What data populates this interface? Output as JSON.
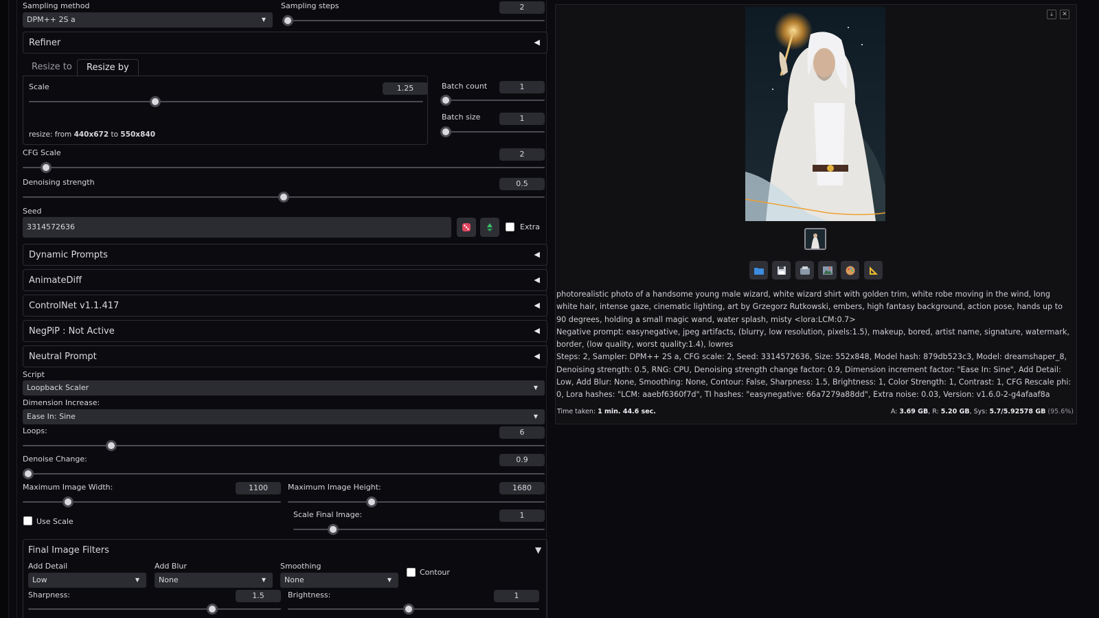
{
  "sampling": {
    "method_label": "Sampling method",
    "method_value": "DPM++ 2S a",
    "steps_label": "Sampling steps",
    "steps_value": "2"
  },
  "refiner": {
    "title": "Refiner"
  },
  "resize_tabs": {
    "tab1": "Resize to",
    "tab2": "Resize by"
  },
  "scale": {
    "label": "Scale",
    "value": "1.25",
    "fraction": 0.32
  },
  "resize_info": {
    "prefix": "resize: from ",
    "from": "440x672",
    "mid": " to ",
    "to": "550x840"
  },
  "batch": {
    "count_label": "Batch count",
    "count_value": "1",
    "size_label": "Batch size",
    "size_value": "1"
  },
  "cfg": {
    "label": "CFG Scale",
    "value": "2",
    "fraction": 0.045
  },
  "denoise": {
    "label": "Denoising strength",
    "value": "0.5",
    "fraction": 0.5
  },
  "seed": {
    "label": "Seed",
    "value": "3314572636",
    "extra_label": "Extra"
  },
  "accordions": {
    "dynamic": "Dynamic Prompts",
    "animatediff": "AnimateDiff",
    "controlnet": "ControlNet v1.1.417",
    "negpip": "NegPiP : Not Active",
    "neutral": "Neutral Prompt"
  },
  "script": {
    "label": "Script",
    "value": "Loopback Scaler"
  },
  "dimension": {
    "label": "Dimension Increase:",
    "value": "Ease In: Sine"
  },
  "loops": {
    "label": "Loops:",
    "value": "6",
    "fraction": 0.17
  },
  "denoise_change": {
    "label": "Denoise Change:",
    "value": "0.9"
  },
  "max_width": {
    "label": "Maximum Image Width:",
    "value": "1100"
  },
  "max_height": {
    "label": "Maximum Image Height:",
    "value": "1680"
  },
  "use_scale": {
    "label": "Use Scale"
  },
  "scale_final": {
    "label": "Scale Final Image:",
    "value": "1"
  },
  "final_filters": {
    "title": "Final Image Filters",
    "add_detail_label": "Add Detail",
    "add_detail_value": "Low",
    "add_blur_label": "Add Blur",
    "add_blur_value": "None",
    "smoothing_label": "Smoothing",
    "smoothing_value": "None",
    "contour_label": "Contour",
    "sharpness_label": "Sharpness:",
    "sharpness_value": "1.5",
    "brightness_label": "Brightness:",
    "brightness_value": "1"
  },
  "output": {
    "prompt": "photorealistic photo of a handsome young male wizard, white wizard shirt with golden trim, white robe moving in the wind, long white hair, intense gaze, cinematic lighting, art by Grzegorz Rutkowski, embers, high fantasy background, action pose, hands up to 90 degrees, holding a small magic wand, water splash, misty <lora:LCM:0.7>",
    "negative": "Negative prompt: easynegative, jpeg artifacts, (blurry, low resolution, pixels:1.5), makeup, bored, artist name, signature, watermark, border, (low quality, worst quality:1.4), lowres",
    "params": "Steps: 2, Sampler: DPM++ 2S a, CFG scale: 2, Seed: 3314572636, Size: 552x848, Model hash: 879db523c3, Model: dreamshaper_8, Denoising strength: 0.5, RNG: CPU, Denoising strength change factor: 0.9, Dimension increment factor: \"Ease In: Sine\", Add Detail: Low, Add Blur: None, Smoothing: None, Contour: False, Sharpness: 1.5, Brightness: 1, Color Strength: 1, Contrast: 1, CFG Rescale phi: 0, Lora hashes: \"LCM: aaebf6360f7d\", TI hashes: \"easynegative: 66a7279a88dd\", Extra noise: 0.03, Version: v1.6.0-2-g4afaaf8a",
    "time_label": "Time taken: ",
    "time_value": "1 min. 44.6 sec.",
    "mem_a_label": "A: ",
    "mem_a": "3.69 GB",
    "mem_r_label": ", R: ",
    "mem_r": "5.20 GB",
    "mem_sys_label": ", Sys: ",
    "mem_sys": "5.7/5.92578 GB",
    "mem_pct": " (95.6%)"
  }
}
